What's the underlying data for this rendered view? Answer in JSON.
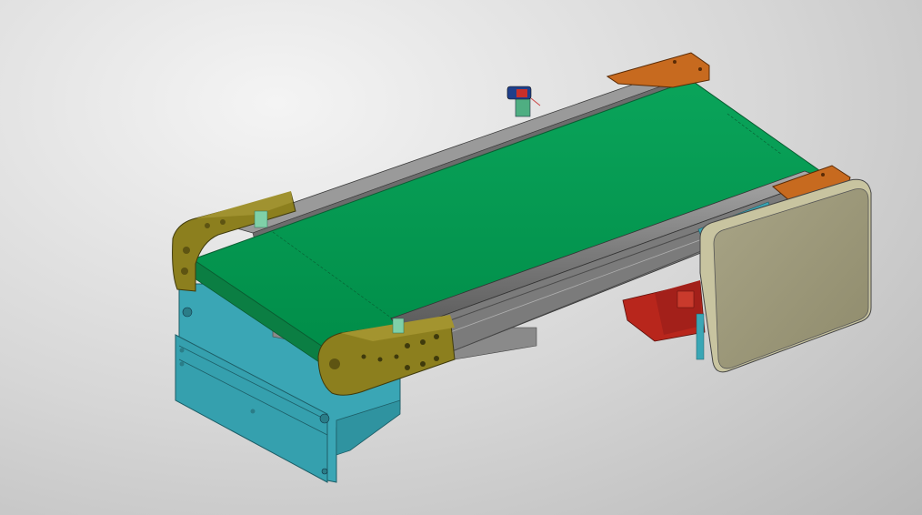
{
  "viewport": {
    "background": "#d4d4d4"
  },
  "model": {
    "object": "belt-conveyor-assembly",
    "colors": {
      "belt": "#009a52",
      "belt_shade": "#0b7e43",
      "rail": "#8c8c8c",
      "rail_dark": "#5e5e5e",
      "end_cap_left": "#8c7f1e",
      "end_cap_right": "#c76a1f",
      "bracket": "#3aa6b5",
      "motor": "#b8261c",
      "cover": "#9c9878",
      "spacer": "#7fd0a8"
    }
  }
}
